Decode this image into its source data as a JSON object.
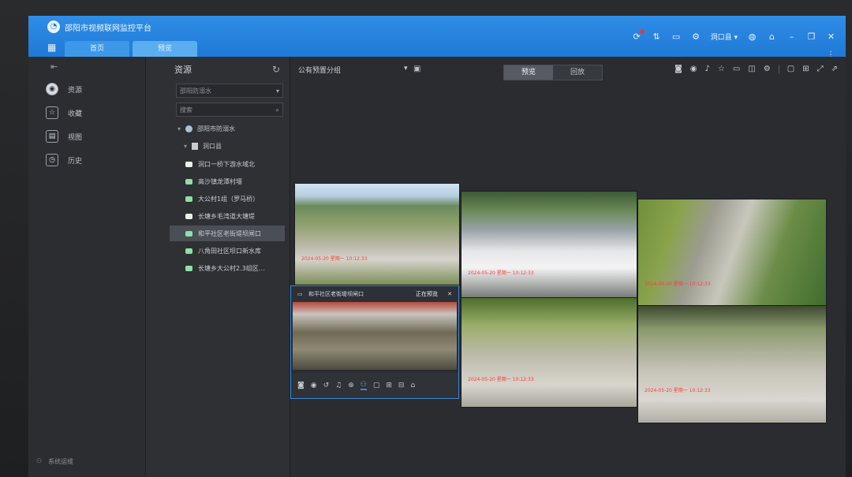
{
  "app": {
    "logo_glyph": "◔",
    "title": "邵阳市视频联网监控平台"
  },
  "tabs": [
    {
      "label": "首页",
      "active": false
    },
    {
      "label": "预览",
      "active": true
    }
  ],
  "window_tools": {
    "user": "洞口县",
    "icons": [
      "notification-icon",
      "transfer-icon",
      "monitor-icon",
      "settings-icon",
      "user-icon",
      "globe-icon",
      "lock-icon",
      "minimize-icon",
      "close-icon"
    ]
  },
  "leftnav": {
    "items": [
      {
        "label": "资源",
        "icon": "resource-icon",
        "glyph": "◉",
        "active": true
      },
      {
        "label": "收藏",
        "icon": "star-icon",
        "glyph": "☆",
        "active": false
      },
      {
        "label": "视图",
        "icon": "view-icon",
        "glyph": "▤",
        "active": false
      },
      {
        "label": "历史",
        "icon": "history-icon",
        "glyph": "◷",
        "active": false
      }
    ],
    "footer": "系统运维"
  },
  "resources": {
    "title": "资源",
    "filter_value": "邵阳防溺水",
    "search_placeholder": "搜索",
    "tree": {
      "root": "邵阳市防溺水",
      "county": "洞口县",
      "cameras": [
        {
          "label": "洞口一桥下游水域北",
          "green": false,
          "selected": false
        },
        {
          "label": "高沙镇龙潭村堰",
          "green": true,
          "selected": false
        },
        {
          "label": "大公村1组（罗马桥）",
          "green": true,
          "selected": false
        },
        {
          "label": "长塘乡毛湾道大塘堤",
          "green": false,
          "selected": false
        },
        {
          "label": "和平社区老街堤坝闸口",
          "green": true,
          "selected": true
        },
        {
          "label": "八角田社区坝口新水库",
          "green": true,
          "selected": false
        },
        {
          "label": "长塘乡大公村2.3组区…",
          "green": true,
          "selected": false
        }
      ]
    }
  },
  "main": {
    "group_select": "公有预置分组",
    "mode": {
      "preview": "预览",
      "playback": "回放"
    },
    "toolbar_icons": [
      "camera-icon",
      "record-icon",
      "audio-icon",
      "star-icon",
      "screen-icon",
      "map-icon",
      "gear-icon",
      "window-icon",
      "grid-icon",
      "fullscreen-icon",
      "popout-icon"
    ],
    "tiles": [
      {
        "caption": "2024-05-20 星期一 10:12:33"
      },
      {
        "caption": "2024-05-20 星期一 10:12:33"
      },
      {
        "caption": "2024-05-20 星期一 10:12:33"
      },
      {
        "name": "和平社区老街堤坝闸口",
        "status": "正在预览",
        "caption": ""
      },
      {
        "caption": "2024-05-20 星期一 10:12:33"
      },
      {
        "caption": "2024-05-20 星期一 10:12:33"
      }
    ]
  }
}
